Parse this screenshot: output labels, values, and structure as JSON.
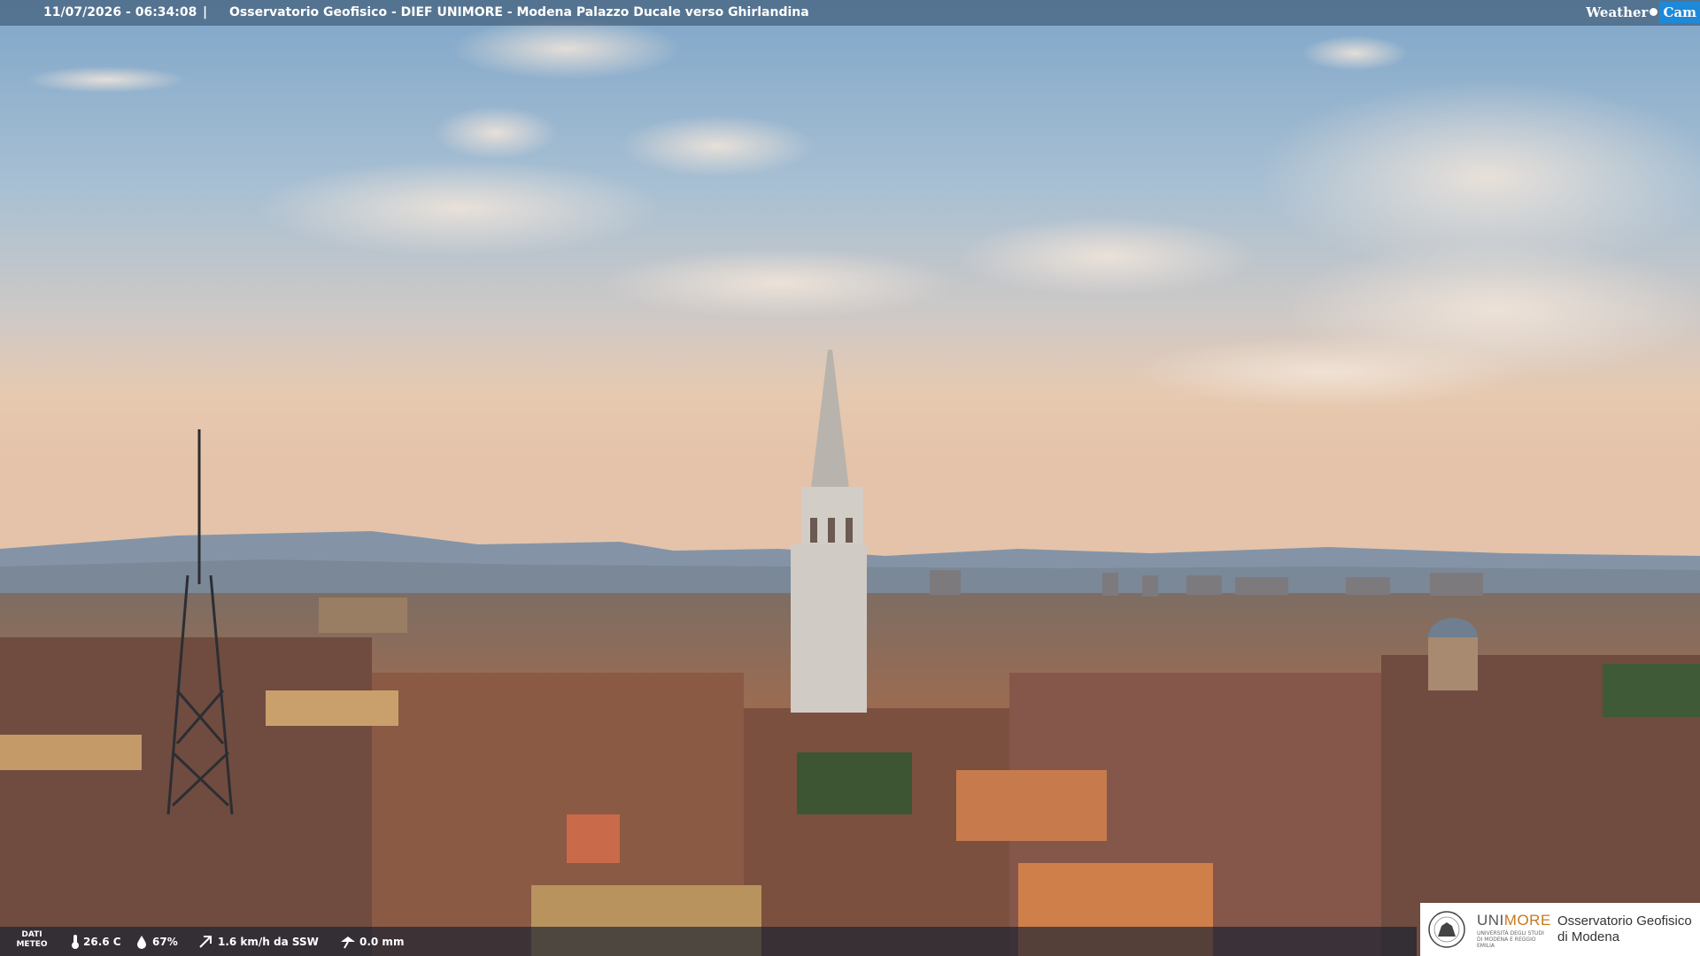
{
  "overlay": {
    "datetime": "11/07/2026 - 06:34:08",
    "separator": "|",
    "location": "Osservatorio Geofisico - DIEF UNIMORE - Modena Palazzo Ducale verso Ghirlandina",
    "brand_weather": "Weather",
    "brand_cam": "Cam"
  },
  "meteo": {
    "label_line1": "DATI",
    "label_line2": "METEO",
    "temperature": "26.6 C",
    "humidity": "67%",
    "wind": "1.6 km/h da SSW",
    "rain": "0.0 mm",
    "icons": [
      "thermometer-icon",
      "humidity-drop-icon",
      "wind-icon",
      "rain-gauge-icon"
    ]
  },
  "logo": {
    "uni_part1": "UNI",
    "uni_part2": "MORE",
    "university_sub": "UNIVERSITÀ DEGLI STUDI DI MODENA E REGGIO EMILIA",
    "observatory_line1": "Osservatorio Geofisico",
    "observatory_line2": "di Modena"
  },
  "colors": {
    "sky_top": "#7fa6c9",
    "sky_horizon": "#e8c9ae",
    "mountains": "#7f90a3",
    "roofs": "#8a5a45",
    "brand_cam": "#1d89d8",
    "unimore_orange": "#c6771f"
  }
}
